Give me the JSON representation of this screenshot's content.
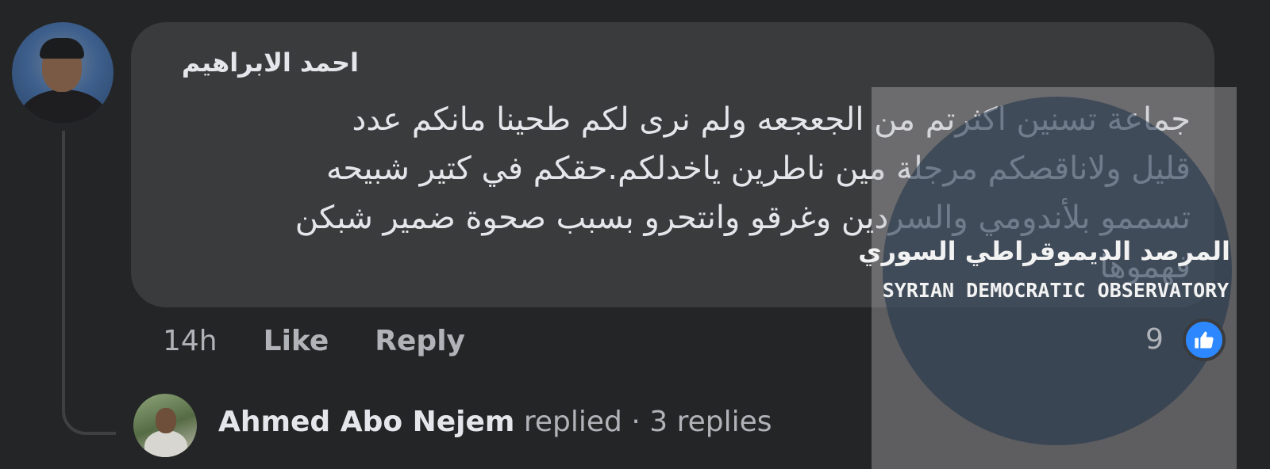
{
  "comment": {
    "author": "احمد الابراهيم",
    "lines": [
      "جماعة تسنين اكثرتم من الجعجعه ولم نرى لكم طحينا  مانكم عدد",
      "قليل ولاناقصكم مرجلة مين ناطرين ياخدلكم.حقكم في كتير شبيحه",
      "تسممو بلأندومي والسردين  وغرقو وانتحرو بسبب صحوة ضمير شبكن",
      "فهموها"
    ],
    "time": "14h",
    "like_label": "Like",
    "reply_label": "Reply",
    "reaction_count": "9",
    "reaction_icon": "thumbs-up-icon"
  },
  "replies": {
    "name": "Ahmed Abo Nejem",
    "text": " replied · 3 replies"
  },
  "watermark": {
    "arabic": "المرصد الديموقراطي السوري",
    "english": "SYRIAN DEMOCRATIC OBSERVATORY"
  },
  "colors": {
    "background": "#242526",
    "bubble": "#3a3b3c",
    "accent": "#2d88ff"
  }
}
